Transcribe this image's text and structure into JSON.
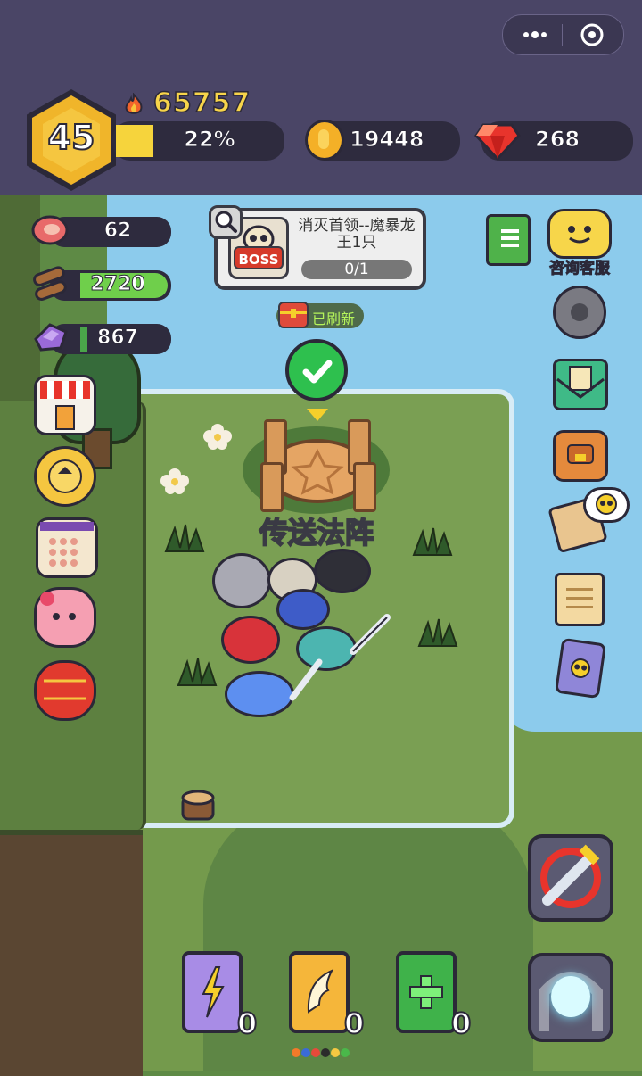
{
  "header": {
    "level": "45",
    "score": "65757",
    "xp_percent_label": "22%",
    "xp_fraction": 0.22,
    "gold": "19448",
    "gems": "268"
  },
  "resources": [
    {
      "name": "meat",
      "value": "62",
      "fill_color": "#2e2b3e"
    },
    {
      "name": "wood",
      "value": "2720",
      "fill_color": "#6fcf4b"
    },
    {
      "name": "ore",
      "value": "867",
      "fill_color": "#4aa54a"
    }
  ],
  "boss_quest": {
    "badge": "BOSS",
    "title": "消灭首领--魔暴龙王1只",
    "progress": "0/1"
  },
  "refresh_label": "已刷新",
  "portal_label": "传送法阵",
  "support_label": "咨询客服",
  "skill_books": [
    {
      "icon": "lightning-book-icon",
      "color": "#a88ce6",
      "count": "0"
    },
    {
      "icon": "wing-book-icon",
      "color": "#f5b63a",
      "count": "0"
    },
    {
      "icon": "heal-book-icon",
      "color": "#3fb24a",
      "count": "0"
    }
  ],
  "page_dots": [
    "#f27a2a",
    "#3a6bd8",
    "#e84a3a",
    "#2b2b2b",
    "#f5c842",
    "#4ab84a"
  ],
  "colors": {
    "header_bg": "#4a4566",
    "accent_gold": "#f6d43c",
    "lake": "#8ccbec",
    "grass": "#749a4c"
  }
}
